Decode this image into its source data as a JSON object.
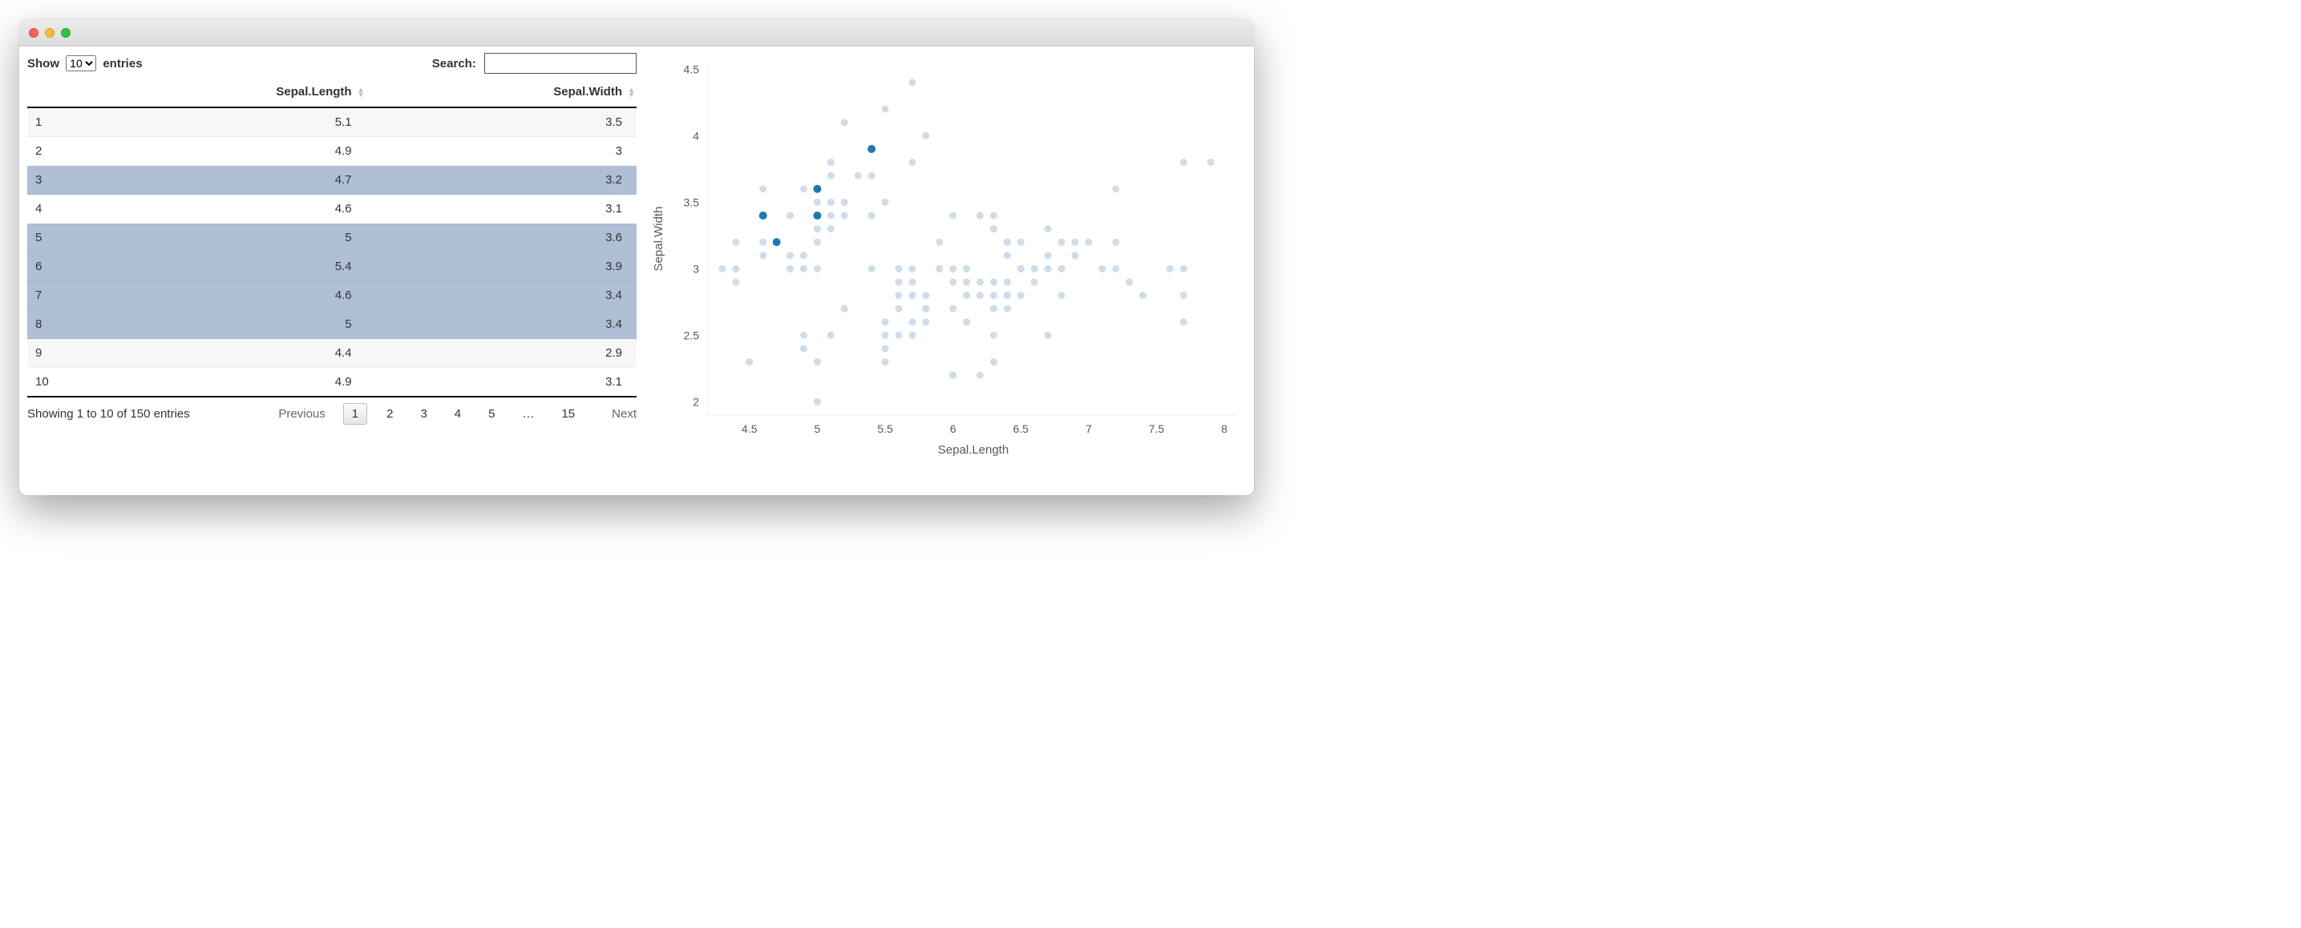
{
  "table": {
    "length_control": {
      "prefix": "Show",
      "value": "10",
      "suffix": "entries"
    },
    "search": {
      "label": "Search:",
      "value": ""
    },
    "columns": [
      "",
      "Sepal.Length",
      "Sepal.Width"
    ],
    "rows": [
      {
        "idx": "1",
        "sepal_length": "5.1",
        "sepal_width": "3.5",
        "selected": false
      },
      {
        "idx": "2",
        "sepal_length": "4.9",
        "sepal_width": "3",
        "selected": false
      },
      {
        "idx": "3",
        "sepal_length": "4.7",
        "sepal_width": "3.2",
        "selected": true
      },
      {
        "idx": "4",
        "sepal_length": "4.6",
        "sepal_width": "3.1",
        "selected": false
      },
      {
        "idx": "5",
        "sepal_length": "5",
        "sepal_width": "3.6",
        "selected": true
      },
      {
        "idx": "6",
        "sepal_length": "5.4",
        "sepal_width": "3.9",
        "selected": true
      },
      {
        "idx": "7",
        "sepal_length": "4.6",
        "sepal_width": "3.4",
        "selected": true
      },
      {
        "idx": "8",
        "sepal_length": "5",
        "sepal_width": "3.4",
        "selected": true
      },
      {
        "idx": "9",
        "sepal_length": "4.4",
        "sepal_width": "2.9",
        "selected": false
      },
      {
        "idx": "10",
        "sepal_length": "4.9",
        "sepal_width": "3.1",
        "selected": false
      }
    ],
    "info": "Showing 1 to 10 of 150 entries",
    "pagination": {
      "previous": "Previous",
      "next": "Next",
      "pages": [
        "1",
        "2",
        "3",
        "4",
        "5",
        "…",
        "15"
      ],
      "current": "1"
    }
  },
  "chart_data": {
    "type": "scatter",
    "xlabel": "Sepal.Length",
    "ylabel": "Sepal.Width",
    "xlim": [
      4.2,
      8.1
    ],
    "ylim": [
      1.9,
      4.55
    ],
    "xticks": [
      4.5,
      5,
      5.5,
      6,
      6.5,
      7,
      7.5,
      8
    ],
    "yticks": [
      2,
      2.5,
      3,
      3.5,
      4,
      4.5
    ],
    "selected_points": [
      {
        "x": 4.7,
        "y": 3.2
      },
      {
        "x": 5.0,
        "y": 3.6
      },
      {
        "x": 5.4,
        "y": 3.9
      },
      {
        "x": 4.6,
        "y": 3.4
      },
      {
        "x": 5.0,
        "y": 3.4
      }
    ],
    "points": [
      {
        "x": 5.1,
        "y": 3.5
      },
      {
        "x": 4.9,
        "y": 3.0
      },
      {
        "x": 4.7,
        "y": 3.2
      },
      {
        "x": 4.6,
        "y": 3.1
      },
      {
        "x": 5.0,
        "y": 3.6
      },
      {
        "x": 5.4,
        "y": 3.9
      },
      {
        "x": 4.6,
        "y": 3.4
      },
      {
        "x": 5.0,
        "y": 3.4
      },
      {
        "x": 4.4,
        "y": 2.9
      },
      {
        "x": 4.9,
        "y": 3.1
      },
      {
        "x": 5.4,
        "y": 3.7
      },
      {
        "x": 4.8,
        "y": 3.4
      },
      {
        "x": 4.8,
        "y": 3.0
      },
      {
        "x": 4.3,
        "y": 3.0
      },
      {
        "x": 5.8,
        "y": 4.0
      },
      {
        "x": 5.7,
        "y": 4.4
      },
      {
        "x": 5.4,
        "y": 3.9
      },
      {
        "x": 5.1,
        "y": 3.5
      },
      {
        "x": 5.7,
        "y": 3.8
      },
      {
        "x": 5.1,
        "y": 3.8
      },
      {
        "x": 5.4,
        "y": 3.4
      },
      {
        "x": 5.1,
        "y": 3.7
      },
      {
        "x": 4.6,
        "y": 3.6
      },
      {
        "x": 5.1,
        "y": 3.3
      },
      {
        "x": 4.8,
        "y": 3.4
      },
      {
        "x": 5.0,
        "y": 3.0
      },
      {
        "x": 5.0,
        "y": 3.4
      },
      {
        "x": 5.2,
        "y": 3.5
      },
      {
        "x": 5.2,
        "y": 3.4
      },
      {
        "x": 4.7,
        "y": 3.2
      },
      {
        "x": 4.8,
        "y": 3.1
      },
      {
        "x": 5.4,
        "y": 3.4
      },
      {
        "x": 5.2,
        "y": 4.1
      },
      {
        "x": 5.5,
        "y": 4.2
      },
      {
        "x": 4.9,
        "y": 3.1
      },
      {
        "x": 5.0,
        "y": 3.2
      },
      {
        "x": 5.5,
        "y": 3.5
      },
      {
        "x": 4.9,
        "y": 3.6
      },
      {
        "x": 4.4,
        "y": 3.0
      },
      {
        "x": 5.1,
        "y": 3.4
      },
      {
        "x": 5.0,
        "y": 3.5
      },
      {
        "x": 4.5,
        "y": 2.3
      },
      {
        "x": 4.4,
        "y": 3.2
      },
      {
        "x": 5.0,
        "y": 3.5
      },
      {
        "x": 5.1,
        "y": 3.8
      },
      {
        "x": 4.8,
        "y": 3.0
      },
      {
        "x": 5.1,
        "y": 3.8
      },
      {
        "x": 4.6,
        "y": 3.2
      },
      {
        "x": 5.3,
        "y": 3.7
      },
      {
        "x": 5.0,
        "y": 3.3
      },
      {
        "x": 7.0,
        "y": 3.2
      },
      {
        "x": 6.4,
        "y": 3.2
      },
      {
        "x": 6.9,
        "y": 3.1
      },
      {
        "x": 5.5,
        "y": 2.3
      },
      {
        "x": 6.5,
        "y": 2.8
      },
      {
        "x": 5.7,
        "y": 2.8
      },
      {
        "x": 6.3,
        "y": 3.3
      },
      {
        "x": 4.9,
        "y": 2.4
      },
      {
        "x": 6.6,
        "y": 2.9
      },
      {
        "x": 5.2,
        "y": 2.7
      },
      {
        "x": 5.0,
        "y": 2.0
      },
      {
        "x": 5.9,
        "y": 3.0
      },
      {
        "x": 6.0,
        "y": 2.2
      },
      {
        "x": 6.1,
        "y": 2.9
      },
      {
        "x": 5.6,
        "y": 2.9
      },
      {
        "x": 6.7,
        "y": 3.1
      },
      {
        "x": 5.6,
        "y": 3.0
      },
      {
        "x": 5.8,
        "y": 2.7
      },
      {
        "x": 6.2,
        "y": 2.2
      },
      {
        "x": 5.6,
        "y": 2.5
      },
      {
        "x": 5.9,
        "y": 3.2
      },
      {
        "x": 6.1,
        "y": 2.8
      },
      {
        "x": 6.3,
        "y": 2.5
      },
      {
        "x": 6.1,
        "y": 2.8
      },
      {
        "x": 6.4,
        "y": 2.9
      },
      {
        "x": 6.6,
        "y": 3.0
      },
      {
        "x": 6.8,
        "y": 2.8
      },
      {
        "x": 6.7,
        "y": 3.0
      },
      {
        "x": 6.0,
        "y": 2.9
      },
      {
        "x": 5.7,
        "y": 2.6
      },
      {
        "x": 5.5,
        "y": 2.4
      },
      {
        "x": 5.5,
        "y": 2.4
      },
      {
        "x": 5.8,
        "y": 2.7
      },
      {
        "x": 6.0,
        "y": 2.7
      },
      {
        "x": 5.4,
        "y": 3.0
      },
      {
        "x": 6.0,
        "y": 3.4
      },
      {
        "x": 6.7,
        "y": 3.1
      },
      {
        "x": 6.3,
        "y": 2.3
      },
      {
        "x": 5.6,
        "y": 3.0
      },
      {
        "x": 5.5,
        "y": 2.5
      },
      {
        "x": 5.5,
        "y": 2.6
      },
      {
        "x": 6.1,
        "y": 3.0
      },
      {
        "x": 5.8,
        "y": 2.6
      },
      {
        "x": 5.0,
        "y": 2.3
      },
      {
        "x": 5.6,
        "y": 2.7
      },
      {
        "x": 5.7,
        "y": 3.0
      },
      {
        "x": 5.7,
        "y": 2.9
      },
      {
        "x": 6.2,
        "y": 2.9
      },
      {
        "x": 5.1,
        "y": 2.5
      },
      {
        "x": 5.7,
        "y": 2.8
      },
      {
        "x": 6.3,
        "y": 3.3
      },
      {
        "x": 5.8,
        "y": 2.7
      },
      {
        "x": 7.1,
        "y": 3.0
      },
      {
        "x": 6.3,
        "y": 2.9
      },
      {
        "x": 6.5,
        "y": 3.0
      },
      {
        "x": 7.6,
        "y": 3.0
      },
      {
        "x": 4.9,
        "y": 2.5
      },
      {
        "x": 7.3,
        "y": 2.9
      },
      {
        "x": 6.7,
        "y": 2.5
      },
      {
        "x": 7.2,
        "y": 3.6
      },
      {
        "x": 6.5,
        "y": 3.2
      },
      {
        "x": 6.4,
        "y": 2.7
      },
      {
        "x": 6.8,
        "y": 3.0
      },
      {
        "x": 5.7,
        "y": 2.5
      },
      {
        "x": 5.8,
        "y": 2.8
      },
      {
        "x": 6.4,
        "y": 3.2
      },
      {
        "x": 6.5,
        "y": 3.0
      },
      {
        "x": 7.7,
        "y": 3.8
      },
      {
        "x": 7.7,
        "y": 2.6
      },
      {
        "x": 6.0,
        "y": 2.2
      },
      {
        "x": 6.9,
        "y": 3.2
      },
      {
        "x": 5.6,
        "y": 2.8
      },
      {
        "x": 7.7,
        "y": 2.8
      },
      {
        "x": 6.3,
        "y": 2.7
      },
      {
        "x": 6.7,
        "y": 3.3
      },
      {
        "x": 7.2,
        "y": 3.2
      },
      {
        "x": 6.2,
        "y": 2.8
      },
      {
        "x": 6.1,
        "y": 3.0
      },
      {
        "x": 6.4,
        "y": 2.8
      },
      {
        "x": 7.2,
        "y": 3.0
      },
      {
        "x": 7.4,
        "y": 2.8
      },
      {
        "x": 7.9,
        "y": 3.8
      },
      {
        "x": 6.4,
        "y": 2.8
      },
      {
        "x": 6.3,
        "y": 2.8
      },
      {
        "x": 6.1,
        "y": 2.6
      },
      {
        "x": 7.7,
        "y": 3.0
      },
      {
        "x": 6.3,
        "y": 3.4
      },
      {
        "x": 6.4,
        "y": 3.1
      },
      {
        "x": 6.0,
        "y": 3.0
      },
      {
        "x": 6.9,
        "y": 3.1
      },
      {
        "x": 6.7,
        "y": 3.1
      },
      {
        "x": 6.9,
        "y": 3.1
      },
      {
        "x": 5.8,
        "y": 2.7
      },
      {
        "x": 6.8,
        "y": 3.2
      },
      {
        "x": 6.7,
        "y": 3.3
      },
      {
        "x": 6.7,
        "y": 3.0
      },
      {
        "x": 6.3,
        "y": 2.5
      },
      {
        "x": 6.5,
        "y": 3.0
      },
      {
        "x": 6.2,
        "y": 3.4
      },
      {
        "x": 5.9,
        "y": 3.0
      }
    ]
  }
}
